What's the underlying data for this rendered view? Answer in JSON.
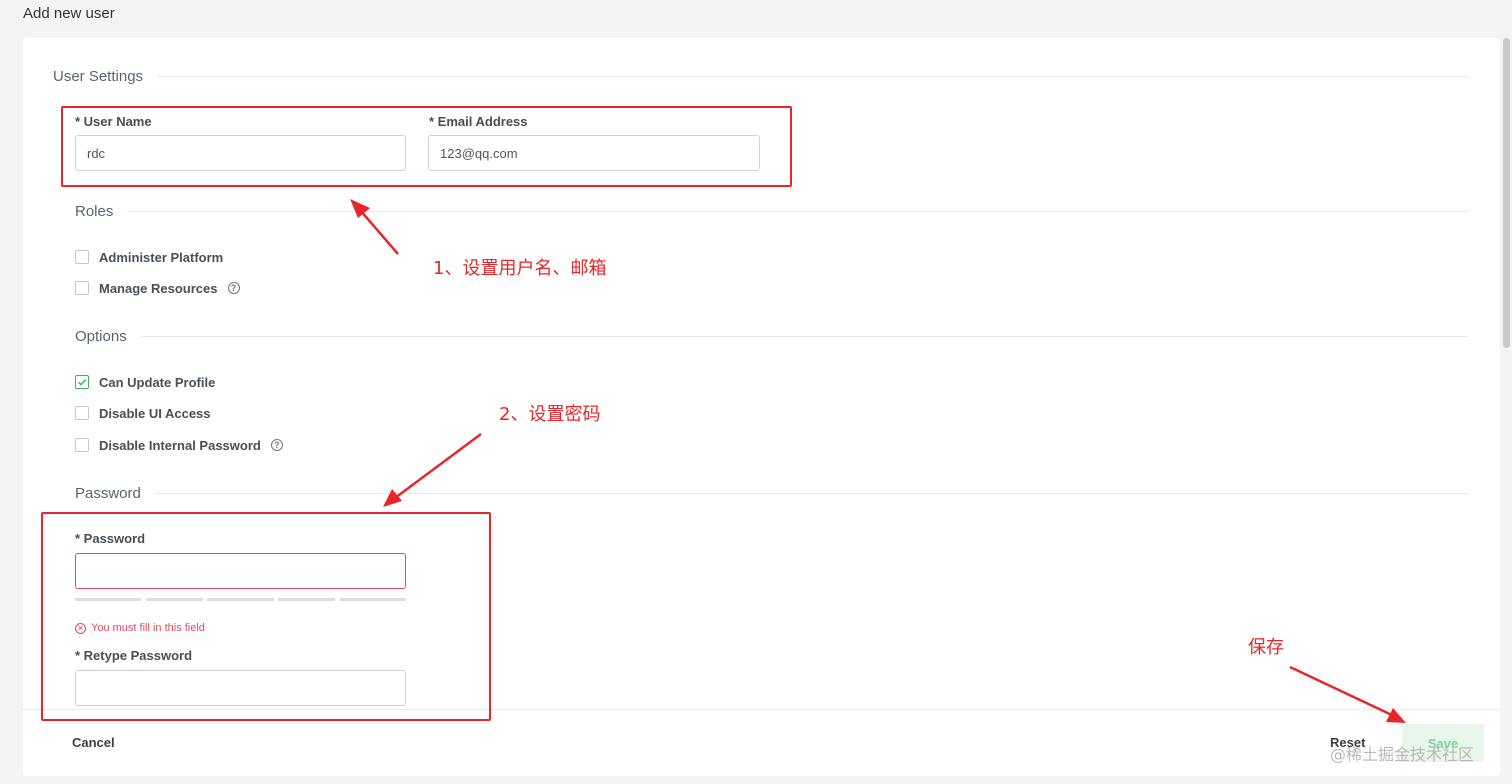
{
  "page": {
    "title": "Add new user"
  },
  "sections": {
    "user_settings": "User Settings",
    "roles": "Roles",
    "options": "Options",
    "password": "Password"
  },
  "fields": {
    "username": {
      "label": "* User Name",
      "value": "rdc"
    },
    "email": {
      "label": "* Email Address",
      "value": "123@qq.com"
    },
    "password": {
      "label": "* Password",
      "value": "",
      "error": "You must fill in this field"
    },
    "retype_password": {
      "label": "* Retype Password",
      "value": ""
    }
  },
  "roles": [
    {
      "label": "Administer Platform",
      "checked": false,
      "help": false
    },
    {
      "label": "Manage Resources",
      "checked": false,
      "help": true
    }
  ],
  "options": [
    {
      "label": "Can Update Profile",
      "checked": true,
      "help": false
    },
    {
      "label": "Disable UI Access",
      "checked": false,
      "help": false
    },
    {
      "label": "Disable Internal Password",
      "checked": false,
      "help": true
    }
  ],
  "footer": {
    "cancel": "Cancel",
    "reset": "Reset",
    "save": "Save"
  },
  "annotations": {
    "step1": "1、设置用户名、邮箱",
    "step2": "2、设置密码",
    "step3": "保存"
  },
  "watermark": "@稀土掘金技术社区",
  "colors": {
    "accent": "#3bb35c",
    "error": "#e24c5e",
    "annotation": "#e8262a"
  }
}
